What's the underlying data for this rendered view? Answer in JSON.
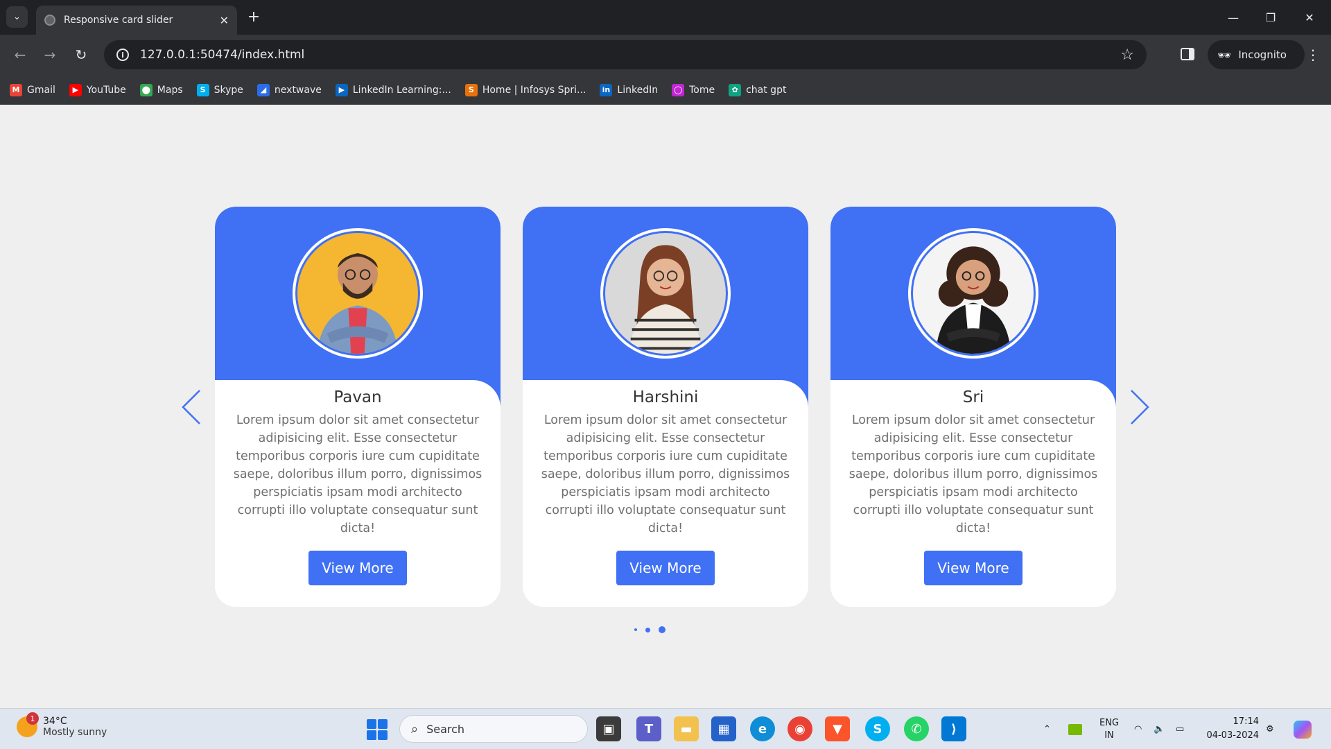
{
  "browser": {
    "tab_title": "Responsive card slider",
    "url": "127.0.0.1:50474/index.html",
    "profile_label": "Incognito"
  },
  "bookmarks": [
    {
      "label": "Gmail",
      "icon": "gmail-icon",
      "color": "#ea4335",
      "glyph": "M"
    },
    {
      "label": "YouTube",
      "icon": "youtube-icon",
      "color": "#ff0000",
      "glyph": "▶"
    },
    {
      "label": "Maps",
      "icon": "maps-icon",
      "color": "#34a853",
      "glyph": "⬤"
    },
    {
      "label": "Skype",
      "icon": "skype-icon",
      "color": "#00aff0",
      "glyph": "S"
    },
    {
      "label": "nextwave",
      "icon": "nextwave-icon",
      "color": "#2b6de8",
      "glyph": "◢"
    },
    {
      "label": "LinkedIn Learning:...",
      "icon": "linkedin-learning-icon",
      "color": "#0a66c2",
      "glyph": "▶"
    },
    {
      "label": "Home | Infosys Spri...",
      "icon": "infosys-icon",
      "color": "#e8710a",
      "glyph": "S"
    },
    {
      "label": "LinkedIn",
      "icon": "linkedin-icon",
      "color": "#0a66c2",
      "glyph": "in"
    },
    {
      "label": "Tome",
      "icon": "tome-icon",
      "color": "#c026d3",
      "glyph": "◯"
    },
    {
      "label": "chat gpt",
      "icon": "chatgpt-icon",
      "color": "#10a37f",
      "glyph": "✿"
    }
  ],
  "cards": [
    {
      "name": "Pavan",
      "description": "Lorem ipsum dolor sit amet consectetur adipisicing elit. Esse consectetur temporibus corporis iure cum cupiditate saepe, doloribus illum porro, dignissimos perspiciatis ipsam modi architecto corrupti illo voluptate consequatur sunt dicta!",
      "button_label": "View More",
      "avatar_bg": "#f5b731"
    },
    {
      "name": "Harshini",
      "description": "Lorem ipsum dolor sit amet consectetur adipisicing elit. Esse consectetur temporibus corporis iure cum cupiditate saepe, doloribus illum porro, dignissimos perspiciatis ipsam modi architecto corrupti illo voluptate consequatur sunt dicta!",
      "button_label": "View More",
      "avatar_bg": "#d9d9d9"
    },
    {
      "name": "Sri",
      "description": "Lorem ipsum dolor sit amet consectetur adipisicing elit. Esse consectetur temporibus corporis iure cum cupiditate saepe, doloribus illum porro, dignissimos perspiciatis ipsam modi architecto corrupti illo voluptate consequatur sunt dicta!",
      "button_label": "View More",
      "avatar_bg": "#f4f4f4"
    }
  ],
  "slider": {
    "accent": "#4070f4",
    "pagination": {
      "count": 3,
      "active_index": 2
    }
  },
  "taskbar": {
    "weather_temp": "34°C",
    "weather_desc": "Mostly sunny",
    "weather_badge": "1",
    "search_placeholder": "Search",
    "lang_line1": "ENG",
    "lang_line2": "IN",
    "time": "17:14",
    "date": "04-03-2024"
  }
}
